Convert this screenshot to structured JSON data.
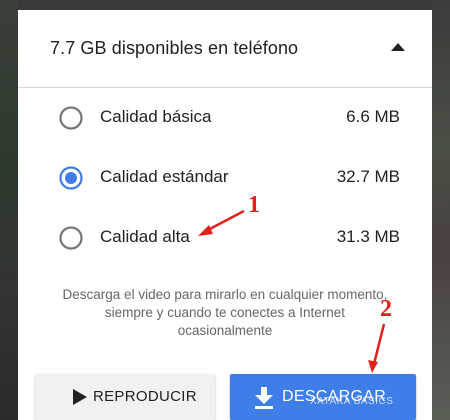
{
  "storage": {
    "title": "7.7 GB disponibles en teléfono",
    "collapse_icon": "arrow-up-icon"
  },
  "quality_options": [
    {
      "label": "Calidad básica",
      "size": "6.6 MB",
      "selected": false
    },
    {
      "label": "Calidad estándar",
      "size": "32.7 MB",
      "selected": true
    },
    {
      "label": "Calidad alta",
      "size": "31.3 MB",
      "selected": false
    }
  ],
  "description": "Descarga el video para mirarlo en cualquier momento, siempre y cuando te conectes a Internet ocasionalmente",
  "buttons": {
    "play_label": "REPRODUCIR",
    "play_icon": "play-icon",
    "download_label": "DESCARGAR",
    "download_icon": "download-icon"
  },
  "annotations": {
    "step1": "1",
    "step2": "2"
  },
  "watermark": "XATAKA BASICS",
  "colors": {
    "accent": "#3f7ee8",
    "annotation": "#e2201c",
    "radio_off": "#757575"
  }
}
